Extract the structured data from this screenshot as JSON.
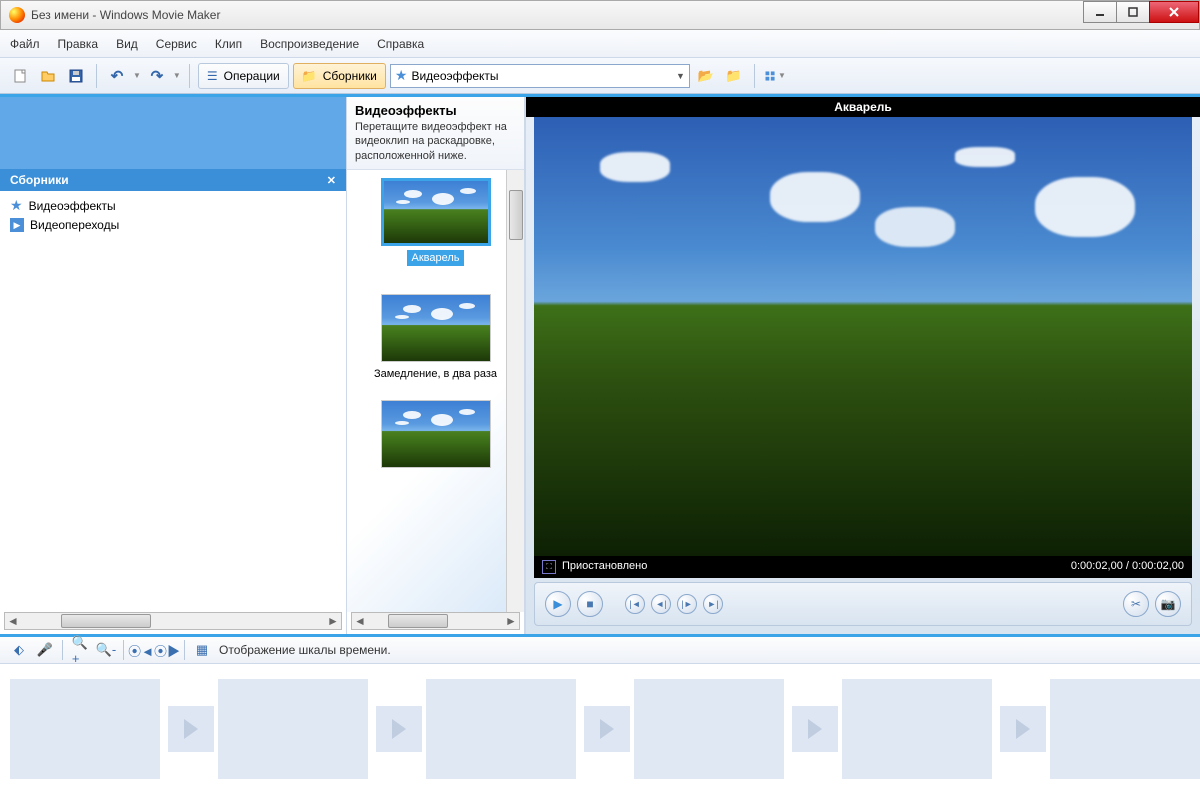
{
  "window": {
    "title": "Без имени - Windows Movie Maker"
  },
  "menu": {
    "file": "Файл",
    "edit": "Правка",
    "view": "Вид",
    "service": "Сервис",
    "clip": "Клип",
    "playback": "Воспроизведение",
    "help": "Справка"
  },
  "toolbar": {
    "operations": "Операции",
    "collections": "Сборники",
    "dropdown_value": "Видеоэффекты"
  },
  "sidebar": {
    "header": "Сборники",
    "items": [
      {
        "label": "Видеоэффекты",
        "icon": "star"
      },
      {
        "label": "Видеопереходы",
        "icon": "arrow"
      }
    ]
  },
  "effects": {
    "title": "Видеоэффекты",
    "hint": "Перетащите видеоэффект на видеоклип на раскадровке, расположенной ниже.",
    "items": [
      {
        "label": "Акварель",
        "selected": true
      },
      {
        "label": "Замедление, в два раза",
        "selected": false
      },
      {
        "label": "",
        "selected": false
      }
    ]
  },
  "preview": {
    "clip_title": "Акварель",
    "status": "Приостановлено",
    "time_current": "0:00:02,00",
    "time_total": "0:00:02,00"
  },
  "timeline": {
    "label": "Отображение шкалы времени."
  }
}
